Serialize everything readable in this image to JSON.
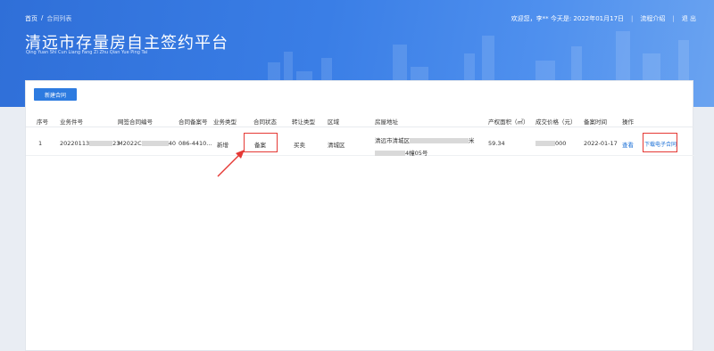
{
  "header": {
    "breadcrumb": [
      "首页",
      "合同列表"
    ],
    "breadcrumb_sep": "/",
    "title": "清远市存量房自主签约平台",
    "subtitle": "Qing Yuan Shi Cun Liang Fang Zi Zhu Qian Yue Ping Tai",
    "welcome": "欢迎您，李** 今天是: 2022年01月17日",
    "guide": "流程介绍",
    "logout": "退 出",
    "sep": "|"
  },
  "toolbar": {
    "new_contract": "新建合同"
  },
  "table": {
    "columns": [
      "序号",
      "业务件号",
      "网签合同编号",
      "合同备案号",
      "业务类型",
      "合同状态",
      "转让类型",
      "区域",
      "房屋地址",
      "产权面积（㎡）",
      "成交价格（元）",
      "备案时间",
      "操作"
    ],
    "rows": [
      {
        "index": "1",
        "biz_no_prefix": "20220113",
        "biz_no_suffix": "23",
        "contract_no_prefix": "M2022C",
        "contract_no_suffix": "40",
        "record_no": "086-4410...",
        "biz_type": "新增",
        "status": "备案",
        "transfer_type": "买卖",
        "area": "清城区",
        "address_line1_prefix": "清远市清城区",
        "address_line1_suffix": "米",
        "address_line2_suffix": "4幢05号",
        "size": "59.34",
        "price_suffix": "000",
        "record_date": "2022-01-17",
        "view": "查看",
        "download": "下载电子合同"
      }
    ]
  },
  "colors": {
    "accent": "#2d7be0",
    "highlight": "#e53935",
    "banner": "#3a7ee6"
  }
}
